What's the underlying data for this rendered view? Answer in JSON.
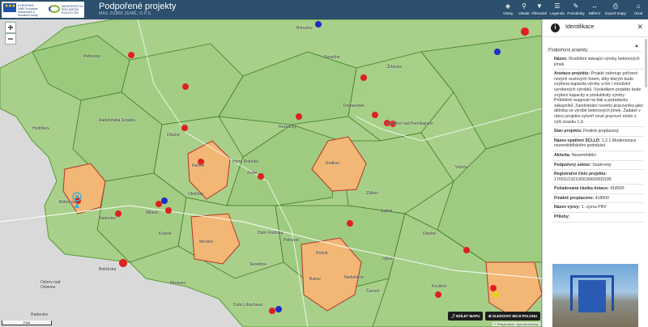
{
  "header": {
    "title": "Podpořené projekty",
    "subtitle": "MAS ZUBRÍ ZEMĚ, O.P.S.",
    "logo": {
      "eu_text": "EVROPSKÁ UNIE Evropské strukturální a investiční fondy",
      "ministry_text": "MINISTERSTVO PRO MÍSTNÍ ROZVOJ ČR"
    },
    "tools": [
      {
        "label": "Vrstvy",
        "icon": "layers-icon"
      },
      {
        "label": "Hledat",
        "icon": "search-icon"
      },
      {
        "label": "Filtrování",
        "icon": "filter-icon"
      },
      {
        "label": "Legenda",
        "icon": "legend-icon"
      },
      {
        "label": "Poznámky",
        "icon": "notes-icon"
      },
      {
        "label": "Měření",
        "icon": "measure-icon"
      },
      {
        "label": "Export mapy",
        "icon": "print-icon"
      },
      {
        "label": "Úvod",
        "icon": "home-icon"
      }
    ]
  },
  "map": {
    "zoom_in": "+",
    "zoom_out": "−",
    "share_button": "SDÍLET MAPU",
    "locate_button": "SLEDOVAT MOJI POLOHU",
    "scale": "2 km",
    "attribution": "© Přispěvatelé OpenStreetMap",
    "towns": [
      "Petrovice",
      "Bohuňov",
      "Rovečné",
      "Žďánice",
      "Domanínek",
      "Bystřice nad Pernštejnem",
      "Rozsochy",
      "Hodíškov",
      "Radešínská Svratka",
      "Dlouhé",
      "Račice",
      "Zvole",
      "Horní Rožínka",
      "Rodkov",
      "Olešínky",
      "Bobrová",
      "Radenice",
      "Milasín",
      "Mirošov",
      "Rožná",
      "Dolní Rožínka",
      "Bobrůvka",
      "Nedvědice",
      "Moravec",
      "Ostrov nad Oslavou",
      "Radenice",
      "Dlouhé",
      "Bukov",
      "Skorotice",
      "Kovářov",
      "Sejřek",
      "Petráveč",
      "Víckov",
      "Ujčov",
      "Černvír",
      "Dolní Libochová",
      "Zlákov",
      "Krásné"
    ]
  },
  "panel": {
    "title": "Identifikace",
    "section": "Podpořené projekty",
    "fields": [
      {
        "label": "Název:",
        "value": "Rozšíření stávající výroby betonových jímek"
      },
      {
        "label": "Anotace projektu:",
        "value": "Projekt zahrnuje pořízení nových ocelových forem, díky kterým bude zvýšena kapacita výroby a tím i množství vyrobených výrobků. Výsledkem projektu bude zvýšení kapacity a produktivity výroby. Průběžně reagovat na tlak a požadavky zákazníků. Zaměstnání nového pracovníka jako dělníka ve výrobě betonových jímek. Žadatel v rámci projektu vytvoří nové pracovní místo s výší úvazku 1,0."
      },
      {
        "label": "Stav projektu:",
        "value": "Finálně proplacený"
      },
      {
        "label": "Název opatření SCLLD:",
        "value": "1.2.1 Modernizace nezemědělského podnikání"
      },
      {
        "label": "Aktivita:",
        "value": "Nezemědělci"
      },
      {
        "label": "Podpořený sektor:",
        "value": "Soukromý"
      },
      {
        "label": "Registrační číslo projektu:",
        "value": "17/001/19210/563/060/000195"
      },
      {
        "label": "Požadovaná částka dotace:",
        "value": "418500"
      },
      {
        "label": "Finálně proplaceno:",
        "value": "418500"
      },
      {
        "label": "Název výzvy:",
        "value": "1. výzva PRV"
      },
      {
        "label": "Přílohy:",
        "value": ""
      }
    ]
  }
}
